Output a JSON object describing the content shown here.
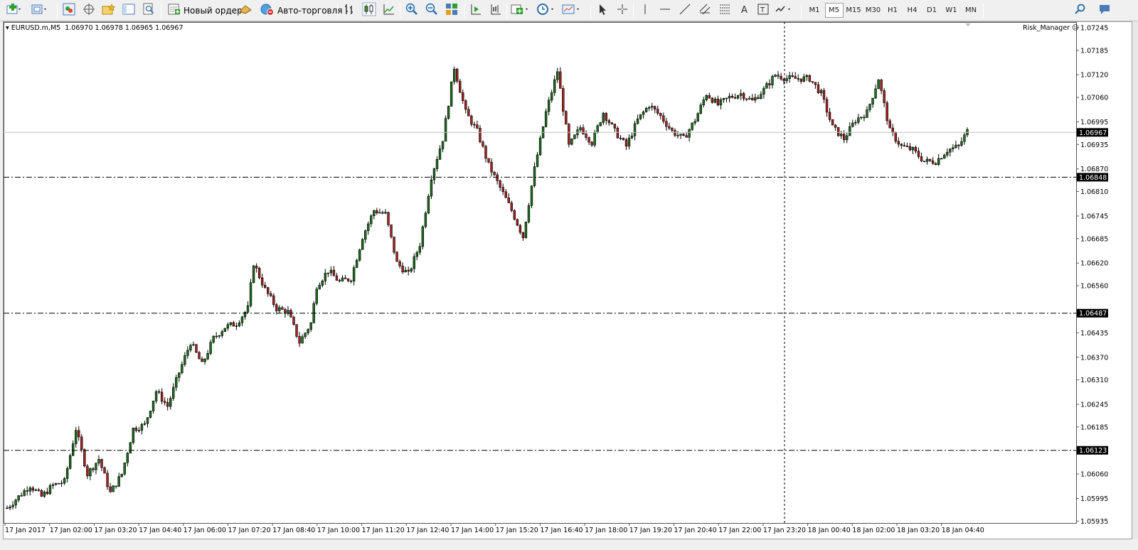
{
  "toolbar": {
    "new_order_label": "Новый ордер",
    "auto_trading_label": "Авто-торговля",
    "timeframes": [
      "M1",
      "M5",
      "M15",
      "M30",
      "H1",
      "H4",
      "D1",
      "W1",
      "MN"
    ],
    "active_timeframe": "M5"
  },
  "chart": {
    "symbol_info": "EURUSD.m,M5  1.06970 1.06978 1.06965 1.06967",
    "indicator_label": "Risk_Manager",
    "price_ticks": [
      "1.07245",
      "1.07185",
      "1.07120",
      "1.07060",
      "1.06995",
      "1.06935",
      "1.06870",
      "1.06810",
      "1.06745",
      "1.06685",
      "1.06620",
      "1.06560",
      "1.06435",
      "1.06370",
      "1.06310",
      "1.06245",
      "1.06185",
      "1.06060",
      "1.05995",
      "1.05935"
    ],
    "time_ticks": [
      "17 Jan 2017",
      "17 Jan 02:00",
      "17 Jan 03:20",
      "17 Jan 04:40",
      "17 Jan 06:00",
      "17 Jan 07:20",
      "17 Jan 08:40",
      "17 Jan 10:00",
      "17 Jan 11:20",
      "17 Jan 12:40",
      "17 Jan 14:00",
      "17 Jan 15:20",
      "17 Jan 16:40",
      "17 Jan 18:00",
      "17 Jan 19:20",
      "17 Jan 20:40",
      "17 Jan 22:00",
      "17 Jan 23:20",
      "18 Jan 00:40",
      "18 Jan 02:00",
      "18 Jan 03:20",
      "18 Jan 04:40"
    ],
    "current_price": "1.06967",
    "levels": [
      "1.06848",
      "1.06487",
      "1.06123"
    ],
    "colors": {
      "bull": "#1f6e1f",
      "bear": "#a52121",
      "level_label_bg": "#000000",
      "bid_line": "#c0c0c0"
    }
  },
  "chart_data": {
    "type": "candlestick",
    "y_range": [
      1.0593,
      1.0726
    ],
    "close_path": [
      [
        0,
        1.0597
      ],
      [
        8,
        1.0603
      ],
      [
        12,
        1.06
      ],
      [
        16,
        1.0603
      ],
      [
        20,
        1.0604
      ],
      [
        24,
        1.0618
      ],
      [
        28,
        1.0606
      ],
      [
        32,
        1.061
      ],
      [
        36,
        1.0601
      ],
      [
        40,
        1.0606
      ],
      [
        44,
        1.0618
      ],
      [
        48,
        1.0619
      ],
      [
        52,
        1.0628
      ],
      [
        56,
        1.0624
      ],
      [
        60,
        1.0633
      ],
      [
        64,
        1.0641
      ],
      [
        68,
        1.0635
      ],
      [
        72,
        1.0642
      ],
      [
        76,
        1.0645
      ],
      [
        80,
        1.0646
      ],
      [
        84,
        1.065
      ],
      [
        86,
        1.0662
      ],
      [
        90,
        1.0655
      ],
      [
        94,
        1.065
      ],
      [
        98,
        1.0649
      ],
      [
        102,
        1.0641
      ],
      [
        106,
        1.0646
      ],
      [
        108,
        1.0656
      ],
      [
        112,
        1.066
      ],
      [
        116,
        1.0657
      ],
      [
        120,
        1.0658
      ],
      [
        124,
        1.0669
      ],
      [
        128,
        1.0676
      ],
      [
        132,
        1.0675
      ],
      [
        136,
        1.0662
      ],
      [
        140,
        1.0659
      ],
      [
        144,
        1.0667
      ],
      [
        148,
        1.0685
      ],
      [
        152,
        1.0695
      ],
      [
        156,
        1.0714
      ],
      [
        160,
        1.0702
      ],
      [
        164,
        1.0697
      ],
      [
        168,
        1.0688
      ],
      [
        172,
        1.0682
      ],
      [
        176,
        1.0676
      ],
      [
        180,
        1.0669
      ],
      [
        184,
        1.0687
      ],
      [
        188,
        1.0702
      ],
      [
        192,
        1.0713
      ],
      [
        196,
        1.0693
      ],
      [
        200,
        1.0698
      ],
      [
        204,
        1.0694
      ],
      [
        208,
        1.0702
      ],
      [
        212,
        1.0697
      ],
      [
        216,
        1.0693
      ],
      [
        220,
        1.07
      ],
      [
        224,
        1.0704
      ],
      [
        228,
        1.0701
      ],
      [
        232,
        1.0697
      ],
      [
        236,
        1.0695
      ],
      [
        240,
        1.07
      ],
      [
        244,
        1.0707
      ],
      [
        248,
        1.0704
      ],
      [
        252,
        1.0706
      ],
      [
        256,
        1.0707
      ],
      [
        260,
        1.0705
      ],
      [
        264,
        1.0708
      ],
      [
        268,
        1.0712
      ],
      [
        272,
        1.0711
      ],
      [
        276,
        1.0711
      ],
      [
        280,
        1.0711
      ],
      [
        284,
        1.0707
      ],
      [
        288,
        1.0698
      ],
      [
        292,
        1.0695
      ],
      [
        296,
        1.07
      ],
      [
        300,
        1.0702
      ],
      [
        304,
        1.0711
      ],
      [
        308,
        1.0697
      ],
      [
        312,
        1.0693
      ],
      [
        316,
        1.0692
      ],
      [
        320,
        1.0689
      ],
      [
        324,
        1.0689
      ],
      [
        328,
        1.0692
      ],
      [
        332,
        1.0693
      ],
      [
        335,
        1.0697
      ]
    ]
  }
}
